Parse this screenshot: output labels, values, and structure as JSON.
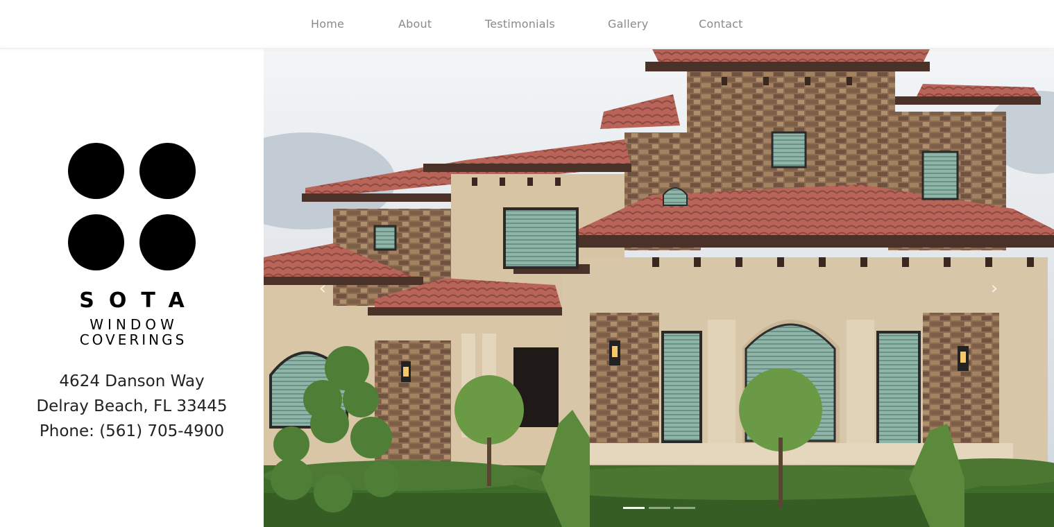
{
  "nav": {
    "items": [
      {
        "label": "Home"
      },
      {
        "label": "About"
      },
      {
        "label": "Testimonials"
      },
      {
        "label": "Gallery"
      },
      {
        "label": "Contact"
      }
    ]
  },
  "brand": {
    "line1": "SOTA",
    "line2": "WINDOW",
    "line3": "COVERINGS",
    "logo_color": "#000000"
  },
  "contact": {
    "street": "4624 Danson Way",
    "city": "Delray Beach, FL 33445",
    "phone": "Phone: (561) 705-4900"
  },
  "slider": {
    "prev_icon": "chevron-left-icon",
    "next_icon": "chevron-right-icon",
    "prev_glyph": "‹",
    "next_glyph": "›",
    "slide_count": 3,
    "active_index": 0
  },
  "colors": {
    "nav_text": "#8a8a8a",
    "roof": "#b5615a",
    "stucco": "#d9c7aa",
    "stone": "#8a6a50",
    "trim": "#4a3228",
    "sky": "#d8dee4",
    "lawn": "#3f6b2b"
  }
}
